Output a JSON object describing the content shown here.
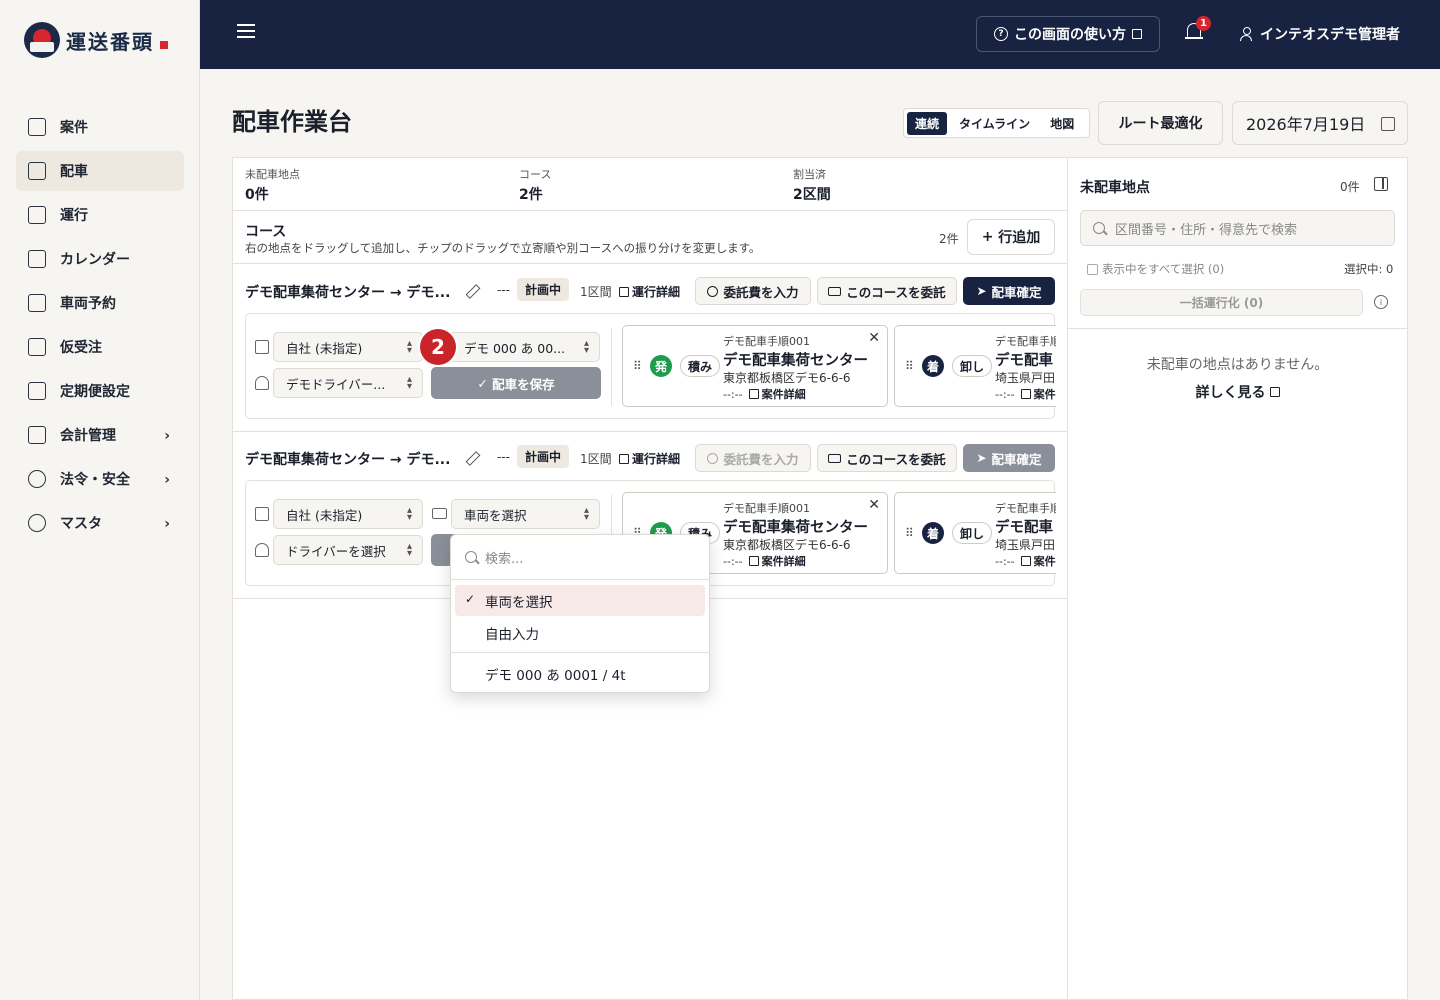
{
  "app": {
    "logo_text": "運送番頭"
  },
  "sidebar": {
    "items": [
      {
        "label": "案件"
      },
      {
        "label": "配車"
      },
      {
        "label": "運行"
      },
      {
        "label": "カレンダー"
      },
      {
        "label": "車両予約"
      },
      {
        "label": "仮受注"
      },
      {
        "label": "定期便設定"
      },
      {
        "label": "会計管理"
      },
      {
        "label": "法令・安全"
      },
      {
        "label": "マスタ"
      }
    ]
  },
  "topbar": {
    "help_label": "この画面の使い方",
    "notification_count": "1",
    "user_name": "インテオスデモ管理者"
  },
  "page": {
    "title": "配車作業台"
  },
  "view_tabs": [
    "連続",
    "タイムライン",
    "地図"
  ],
  "toolbar": {
    "route_optimize": "ルート最適化",
    "date": "2026年7月19日"
  },
  "stats": [
    {
      "label": "未配車地点",
      "value": "0件"
    },
    {
      "label": "コース",
      "value": "2件"
    },
    {
      "label": "割当済",
      "value": "2区間"
    }
  ],
  "courses_header": {
    "title": "コース",
    "description": "右の地点をドラッグして追加し、チップのドラッグで立寄順や別コースへの振り分けを変更します。",
    "count": "2件",
    "add_row": "行追加"
  },
  "course_labels": {
    "dash": "---",
    "status": "計画中",
    "sections": "1区間",
    "run_detail": "運行詳細",
    "input_fee": "委託費を入力",
    "outsource": "このコースを委託",
    "confirm": "配車確定",
    "save": "配車を保存"
  },
  "courses": [
    {
      "title": "デモ配車集荷センター → デモ...",
      "company": "自社 (未指定)",
      "vehicle": "デモ 000 あ 00...",
      "driver": "デモドライバー..."
    },
    {
      "title": "デモ配車集荷センター → デモ...",
      "company": "自社 (未指定)",
      "vehicle": "車両を選択",
      "driver": "ドライバーを選択"
    }
  ],
  "stops": {
    "first": {
      "seq": "デモ配車手順001",
      "type": "発",
      "action": "積み",
      "name": "デモ配車集荷センター",
      "address": "東京都板橋区デモ6-6-6",
      "time": "--:--",
      "detail": "案件詳細"
    },
    "second": {
      "seq": "デモ配車手順",
      "type": "着",
      "action": "卸し",
      "name": "デモ配車",
      "address": "埼玉県戸田",
      "time": "--:--",
      "detail": "案件"
    }
  },
  "step_badge": "2",
  "vehicle_dropdown": {
    "search_placeholder": "検索...",
    "options": [
      "車両を選択",
      "自由入力",
      "デモ 000 あ 0001 / 4t"
    ],
    "selected": "車両を選択"
  },
  "right_panel": {
    "title": "未配車地点",
    "count": "0件",
    "search_placeholder": "区間番号・住所・得意先で検索",
    "select_all": "表示中をすべて選択 (0)",
    "selected_count": "選択中: 0",
    "bulk_run": "一括運行化 (0)",
    "empty_text": "未配車の地点はありません。",
    "more_link": "詳しく見る"
  }
}
